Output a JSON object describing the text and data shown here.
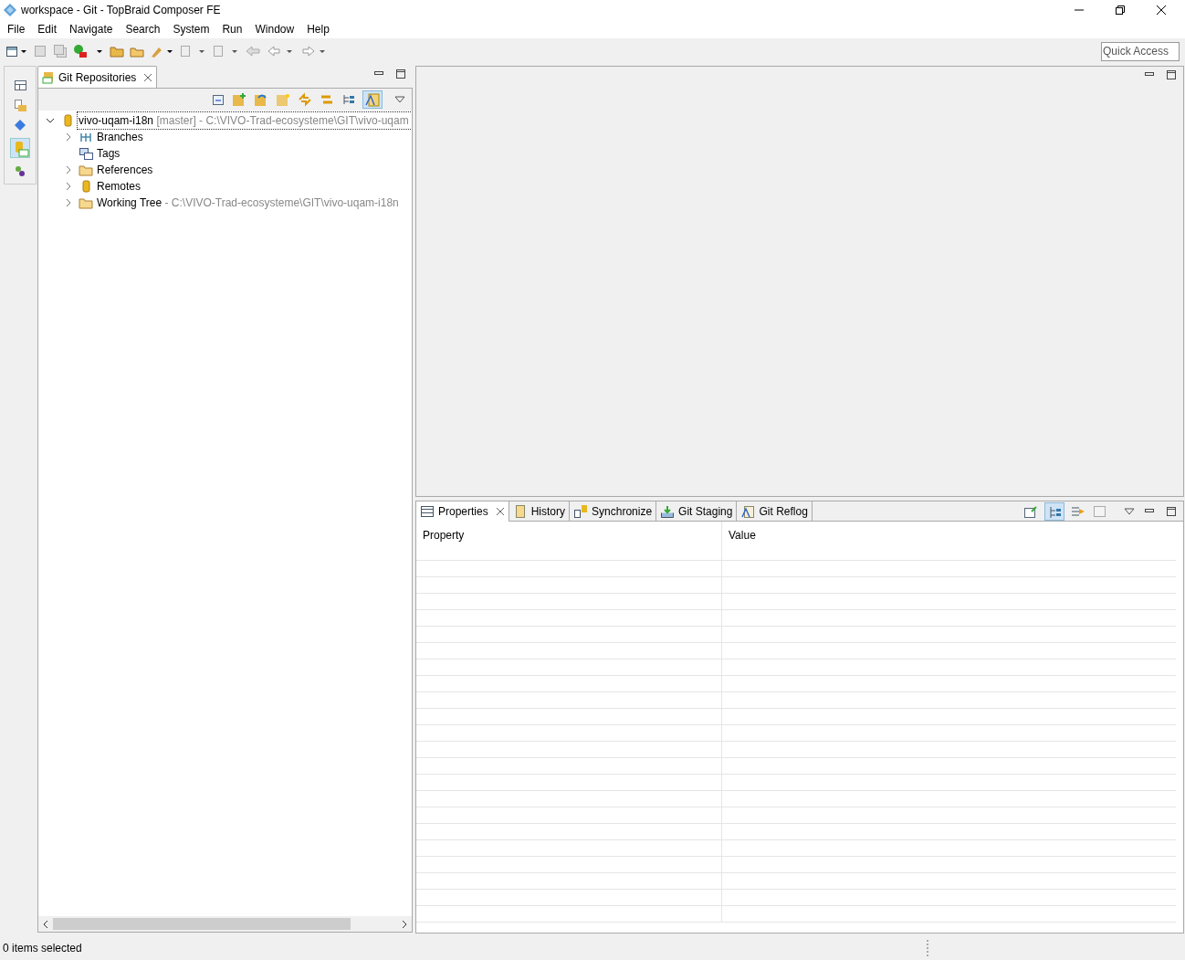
{
  "window": {
    "title": "workspace - Git - TopBraid Composer FE"
  },
  "menu": [
    "File",
    "Edit",
    "Navigate",
    "Search",
    "System",
    "Run",
    "Window",
    "Help"
  ],
  "quick_access": {
    "placeholder": "Quick Access"
  },
  "git_repositories": {
    "tab": {
      "label": "Git Repositories",
      "selected": true
    },
    "tree": [
      {
        "label": "vivo-uqam-i18n",
        "branch": "[master]",
        "path": " - C:\\VIVO-Trad-ecosysteme\\GIT\\vivo-uqam",
        "expanded": true,
        "selected": true,
        "kind": "repository",
        "children": [
          {
            "label": "Branches",
            "kind": "branches",
            "expanded": false,
            "selected": false
          },
          {
            "label": "Tags",
            "kind": "tags",
            "selected": false
          },
          {
            "label": "References",
            "kind": "folder",
            "expanded": false,
            "selected": false
          },
          {
            "label": "Remotes",
            "kind": "repository",
            "expanded": false,
            "selected": false
          },
          {
            "label": "Working Tree",
            "kind": "folder",
            "path": " - C:\\VIVO-Trad-ecosysteme\\GIT\\vivo-uqam-i18n",
            "expanded": false,
            "selected": false
          }
        ]
      }
    ]
  },
  "bottom_tabs": [
    {
      "label": "Properties",
      "selected": true
    },
    {
      "label": "History",
      "selected": false
    },
    {
      "label": "Synchronize",
      "selected": false
    },
    {
      "label": "Git Staging",
      "selected": false
    },
    {
      "label": "Git Reflog",
      "selected": false
    }
  ],
  "properties_table": {
    "columns": [
      "Property",
      "Value"
    ]
  },
  "status_bar": {
    "text": "0 items selected"
  }
}
